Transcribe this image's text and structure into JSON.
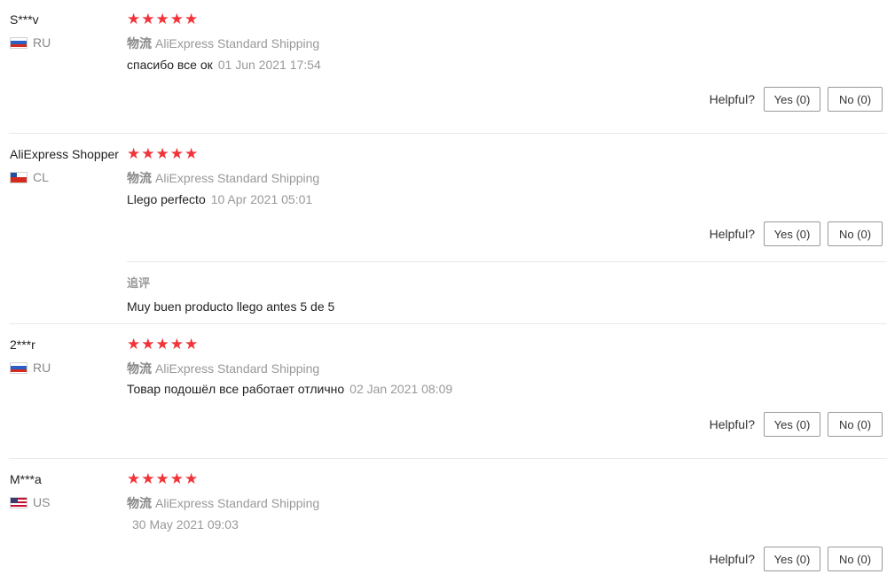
{
  "helpful_label": "Helpful?",
  "reviews": [
    {
      "user": "S***v",
      "country": "RU",
      "flag": "russia-flag-icon",
      "rating": 5,
      "shipping_label": "物流",
      "shipping_method": "AliExpress Standard Shipping",
      "text": "спасибо все ок",
      "date": "01 Jun 2021 17:54",
      "yes": "Yes (0)",
      "no": "No (0)"
    },
    {
      "user": "AliExpress Shopper",
      "country": "CL",
      "flag": "chile-flag-icon",
      "rating": 5,
      "shipping_label": "物流",
      "shipping_method": "AliExpress Standard Shipping",
      "text": "Llego perfecto",
      "date": "10 Apr 2021 05:01",
      "yes": "Yes (0)",
      "no": "No (0)",
      "followup_label": "追评",
      "followup_text": "Muy buen producto llego antes 5 de 5"
    },
    {
      "user": "2***r",
      "country": "RU",
      "flag": "russia-flag-icon",
      "rating": 5,
      "shipping_label": "物流",
      "shipping_method": "AliExpress Standard Shipping",
      "text": "Товар подошёл все работает отлично",
      "date": "02 Jan 2021 08:09",
      "yes": "Yes (0)",
      "no": "No (0)"
    },
    {
      "user": "M***a",
      "country": "US",
      "flag": "us-flag-icon",
      "rating": 5,
      "shipping_label": "物流",
      "shipping_method": "AliExpress Standard Shipping",
      "text": "",
      "date": "30 May 2021 09:03",
      "yes": "Yes (0)",
      "no": "No (0)"
    }
  ],
  "colors": {
    "star": "#f0343a",
    "muted": "#999999",
    "divider": "#e8e8e8"
  }
}
